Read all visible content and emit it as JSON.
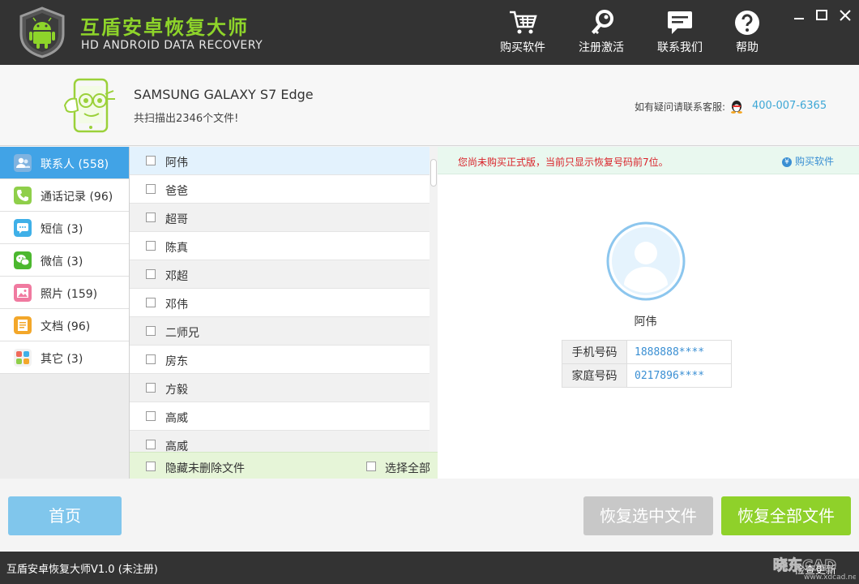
{
  "app": {
    "title": "互盾安卓恢复大师",
    "subtitle": "HD ANDROID DATA RECOVERY"
  },
  "toolbar": {
    "buy_label": "购买软件",
    "register_label": "注册激活",
    "contact_label": "联系我们",
    "help_label": "帮助"
  },
  "device": {
    "name": "SAMSUNG  GALAXY S7 Edge",
    "scan_info": "共扫描出2346个文件!"
  },
  "support": {
    "label": "如有疑问请联系客服:",
    "phone": "400-007-6365"
  },
  "sidebar": {
    "items": [
      {
        "label": "联系人 (558)",
        "icon": "contacts-icon",
        "color": "#7fb3e0"
      },
      {
        "label": "通话记录 (96)",
        "icon": "call-log-icon",
        "color": "#8fcf4a"
      },
      {
        "label": "短信 (3)",
        "icon": "sms-icon",
        "color": "#3fb0e8"
      },
      {
        "label": "微信 (3)",
        "icon": "wechat-icon",
        "color": "#4cb82f"
      },
      {
        "label": "照片 (159)",
        "icon": "photo-icon",
        "color": "#f07aa0"
      },
      {
        "label": "文档 (96)",
        "icon": "document-icon",
        "color": "#f3a72a"
      },
      {
        "label": "其它 (3)",
        "icon": "other-icon",
        "color": "#f0f0f0"
      }
    ]
  },
  "contacts": [
    "阿伟",
    "爸爸",
    "超哥",
    "陈真",
    "邓超",
    "邓伟",
    "二师兄",
    "房东",
    "方毅",
    "高威",
    "高威"
  ],
  "list_footer": {
    "hide_label": "隐藏未删除文件",
    "select_all_label": "选择全部"
  },
  "notice": {
    "text": "您尚未购买正式版，当前只显示恢复号码前7位。",
    "buy_link": "购买软件",
    "yen_symbol": "¥"
  },
  "detail": {
    "name": "阿伟",
    "fields": [
      {
        "label": "手机号码",
        "value": "1888888****"
      },
      {
        "label": "家庭号码",
        "value": "0217896****"
      }
    ]
  },
  "buttons": {
    "home": "首页",
    "recover_selected": "恢复选中文件",
    "recover_all": "恢复全部文件"
  },
  "status": {
    "version": "互盾安卓恢复大师V1.0 (未注册)",
    "check_update": "检查更新"
  },
  "colors": {
    "title_bar": "#333333",
    "brand_green": "#8ed42a",
    "active_blue": "#41a3e6",
    "notice_red": "#d9232a",
    "link_blue": "#3a8fd3"
  }
}
